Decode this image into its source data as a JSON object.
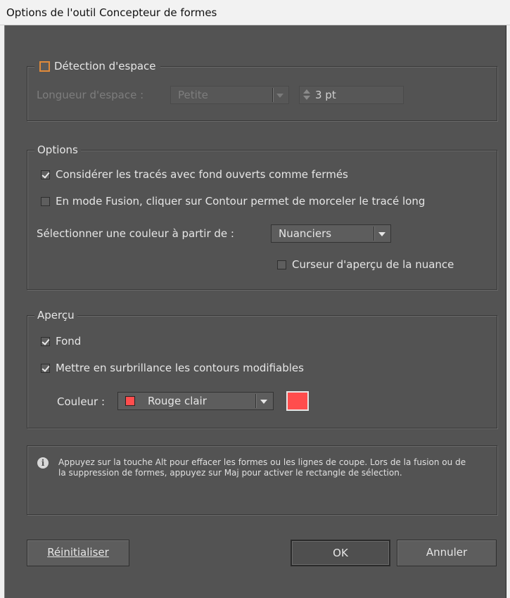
{
  "window": {
    "title": "Options de l'outil Concepteur de formes"
  },
  "gap_detection": {
    "label": "Détection d'espace",
    "checked": false,
    "length_label": "Longueur d'espace :",
    "length_value": "Petite",
    "spin_value": "3 pt"
  },
  "options": {
    "legend": "Options",
    "treat_open": {
      "label": "Considérer les tracés avec fond ouverts comme fermés",
      "checked": true
    },
    "merge_split": {
      "label": "En mode Fusion, cliquer sur Contour permet de morceler le tracé long",
      "checked": false
    },
    "pick_color_label": "Sélectionner une couleur à partir de :",
    "pick_color_value": "Nuanciers",
    "cursor_preview": {
      "label": "Curseur d'aperçu de la nuance",
      "checked": false
    }
  },
  "preview": {
    "legend": "Aperçu",
    "fill": {
      "label": "Fond",
      "checked": true
    },
    "highlight": {
      "label": "Mettre en surbrillance les contours modifiables",
      "checked": true
    },
    "color_label": "Couleur :",
    "color_value": "Rouge clair",
    "swatch_color": "#ff4d4d"
  },
  "info": {
    "icon": "info-icon",
    "text": "Appuyez sur la touche Alt pour effacer les formes ou les lignes de coupe. Lors de la fusion ou de la suppression de formes, appuyez sur Maj pour activer le rectangle de sélection."
  },
  "buttons": {
    "reset": "Réinitialiser",
    "ok": "OK",
    "cancel": "Annuler"
  }
}
